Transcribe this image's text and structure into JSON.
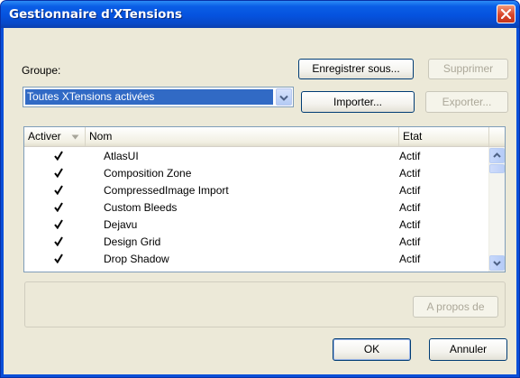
{
  "window": {
    "title": "Gestionnaire d'XTensions"
  },
  "group": {
    "label": "Groupe:",
    "selected": "Toutes XTensions activées"
  },
  "buttons": {
    "save_as": "Enregistrer sous...",
    "delete": "Supprimer",
    "import": "Importer...",
    "export": "Exporter...",
    "about": "A propos de",
    "ok": "OK",
    "cancel": "Annuler"
  },
  "table": {
    "columns": [
      "Activer",
      "Nom",
      "Etat"
    ],
    "rows": [
      {
        "enabled": true,
        "name": "AtlasUI",
        "state": "Actif"
      },
      {
        "enabled": true,
        "name": "Composition Zone",
        "state": "Actif"
      },
      {
        "enabled": true,
        "name": "CompressedImage Import",
        "state": "Actif"
      },
      {
        "enabled": true,
        "name": "Custom Bleeds",
        "state": "Actif"
      },
      {
        "enabled": true,
        "name": "Dejavu",
        "state": "Actif"
      },
      {
        "enabled": true,
        "name": "Design Grid",
        "state": "Actif"
      },
      {
        "enabled": true,
        "name": "Drop Shadow",
        "state": "Actif"
      }
    ]
  },
  "icons": {
    "close": "close-icon",
    "combo_arrow": "chevron-down-icon",
    "sort": "sort-down-icon",
    "check": "checkmark-icon",
    "scroll_up": "scroll-up-icon",
    "scroll_down": "scroll-down-icon"
  },
  "colors": {
    "title_bar": "#0552de",
    "selection": "#316ac5",
    "dialog_bg": "#ece9d8",
    "close_button": "#d8452a"
  }
}
